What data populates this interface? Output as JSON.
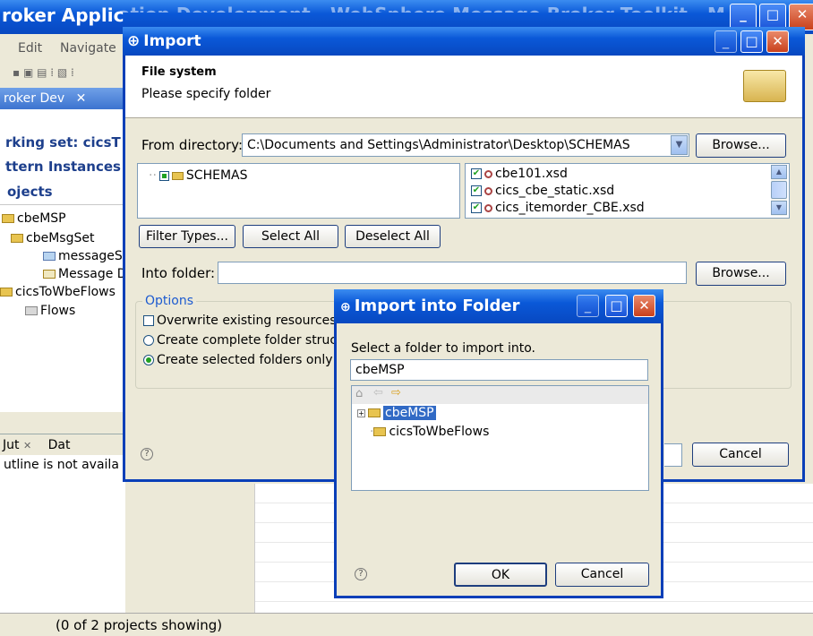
{
  "main_window": {
    "title_fragment": "roker Applic",
    "title_trailing": "ation Development - WebSphere Message Broker Toolkit - M",
    "menu": [
      "Edit",
      "Navigate"
    ],
    "view_tab_label": "roker Dev",
    "working_set_label": "rking set: cicsT",
    "pattern_instances_label": "ttern Instances",
    "projects_label": "ojects",
    "tree": [
      {
        "label": "cbeMSP"
      },
      {
        "label": "cbeMsgSet"
      },
      {
        "label": "messageS"
      },
      {
        "label": "Message D"
      },
      {
        "label": "cicsToWbeFlows"
      },
      {
        "label": "Flows"
      }
    ],
    "outline_tab_label": "Jut",
    "data_tab_label": "Dat",
    "outline_message": "utline is not availa",
    "status_text": "(0 of 2 projects showing)"
  },
  "import_dialog": {
    "title": "Import",
    "section_title": "File system",
    "subtitle": "Please specify folder",
    "from_directory_label": "From directory:",
    "from_directory_value": "C:\\Documents and Settings\\Administrator\\Desktop\\SCHEMAS",
    "browse_label": "Browse...",
    "left_tree_item": "SCHEMAS",
    "files": [
      {
        "name": "cbe101.xsd",
        "checked": true
      },
      {
        "name": "cics_cbe_static.xsd",
        "checked": true
      },
      {
        "name": "cics_itemorder_CBE.xsd",
        "checked": true
      }
    ],
    "filter_types_label": "Filter Types...",
    "select_all_label": "Select All",
    "deselect_all_label": "Deselect All",
    "into_folder_label": "Into folder:",
    "into_folder_value": "",
    "browse2_label": "Browse...",
    "options_label": "Options",
    "overwrite_label": "Overwrite existing resources",
    "create_complete_label": "Create complete folder struc",
    "create_selected_label": "Create selected folders only",
    "cancel_label": "Cancel"
  },
  "folder_dialog": {
    "title": "Import into Folder",
    "prompt": "Select a folder to import into.",
    "input_value": "cbeMSP",
    "tree": [
      {
        "label": "cbeMSP",
        "selected": true
      },
      {
        "label": "cicsToWbeFlows",
        "selected": false
      }
    ],
    "ok_label": "OK",
    "cancel_label": "Cancel"
  },
  "colors": {
    "xp_title_blue": "#0a58d8",
    "window_face": "#ece9d8",
    "selection": "#316ac5"
  },
  "icons": [
    "minimize-icon",
    "maximize-icon",
    "close-icon",
    "help-icon",
    "folder-icon",
    "home-icon",
    "back-arrow-icon",
    "forward-arrow-icon",
    "checkbox-icon",
    "radio-icon"
  ]
}
